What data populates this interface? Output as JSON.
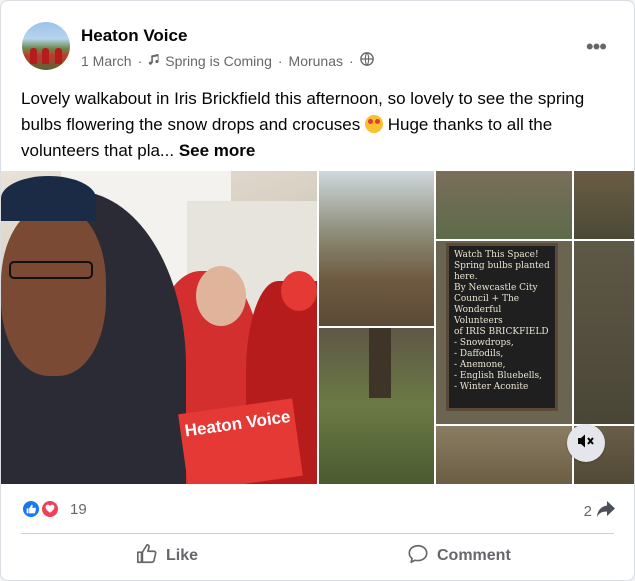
{
  "post": {
    "page_name": "Heaton Voice",
    "date": "1 March",
    "music_label": "Spring is Coming",
    "artist": "Morunas",
    "text": "Lovely walkabout in Iris Brickfield this afternoon, so lovely to see the spring bulbs flowering the snow drops and crocuses",
    "text_after_emoji": " Huge thanks to all the volunteers that pla...",
    "see_more": "See more",
    "emoji_name": "smiling-face-with-hearts",
    "privacy_icon": "globe-icon"
  },
  "photos": {
    "leaflet_text": "Heaton Voice",
    "sign_lines": [
      "Watch This Space!",
      "Spring bulbs planted",
      "here.",
      "By Newcastle City",
      "Council + The",
      "Wonderful Volunteers",
      "of IRIS BRICKFIELD"
    ],
    "sign_items": [
      "- Snowdrops,",
      "- Daffodils,",
      "- Anemone,",
      "- English Bluebells,",
      "- Winter Aconite"
    ]
  },
  "stats": {
    "reaction_count": "19",
    "share_count": "2"
  },
  "actions": {
    "like_label": "Like",
    "comment_label": "Comment"
  },
  "colors": {
    "brand_blue": "#1877f2",
    "love_red": "#f33e58",
    "secondary_text": "#65676b"
  }
}
